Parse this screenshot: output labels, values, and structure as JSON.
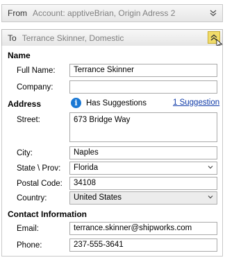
{
  "from": {
    "label": "From",
    "summary": "Account: apptiveBrian, Origin Adress 2"
  },
  "to": {
    "label": "To",
    "summary": "Terrance Skinner, Domestic"
  },
  "name_section": {
    "title": "Name",
    "full_name_label": "Full Name:",
    "full_name_value": "Terrance Skinner",
    "company_label": "Company:",
    "company_value": ""
  },
  "address_section": {
    "title": "Address",
    "suggestions_text": "Has Suggestions",
    "suggestion_link": "1 Suggestion",
    "street_label": "Street:",
    "street_value": "673 Bridge Way",
    "city_label": "City:",
    "city_value": "Naples",
    "state_label": "State \\ Prov:",
    "state_value": "Florida",
    "postal_label": "Postal Code:",
    "postal_value": "34108",
    "country_label": "Country:",
    "country_value": "United States"
  },
  "contact_section": {
    "title": "Contact Information",
    "email_label": "Email:",
    "email_value": "terrance.skinner@shipworks.com",
    "phone_label": "Phone:",
    "phone_value": "237-555-3641"
  },
  "icons": {
    "expand": "chevron-double-down-icon",
    "collapse": "chevron-double-up-icon",
    "info": "info-icon",
    "dropdown": "chevron-down-icon"
  },
  "colors": {
    "collapse_highlight": "#f1dc6a",
    "info_blue": "#1a78d4",
    "link_blue": "#0f3aa8"
  }
}
